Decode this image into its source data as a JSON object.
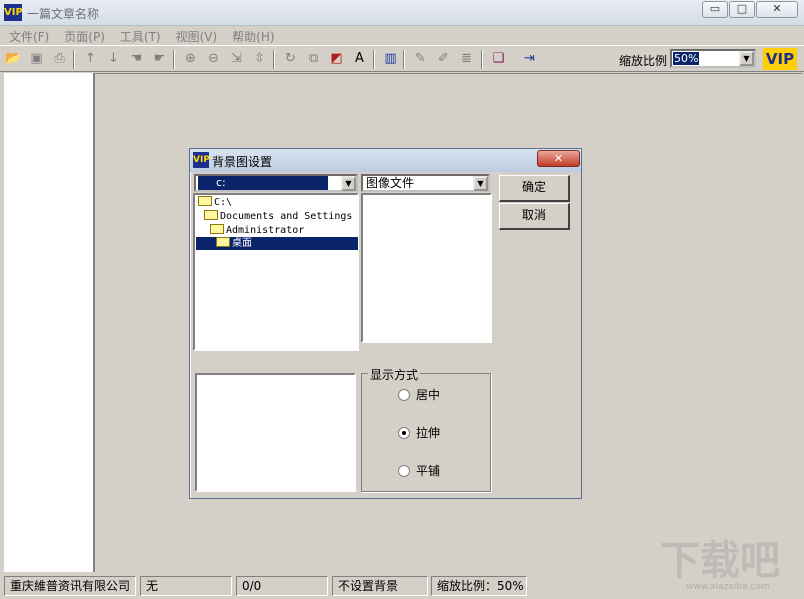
{
  "window": {
    "title": "一篇文章名称",
    "logo_text": "VIP",
    "minimize": "▭",
    "maximize": "□",
    "close": "✕"
  },
  "menu": [
    "文件(F)",
    "页面(P)",
    "工具(T)",
    "视图(V)",
    "帮助(H)"
  ],
  "toolbar": {
    "icons": [
      "open-icon",
      "save-icon",
      "print-icon",
      "arrow-up-icon",
      "arrow-down-icon",
      "hand-icon",
      "hand-right-icon",
      "zoom-in-icon",
      "zoom-out-icon",
      "rotate-left-icon",
      "rotate-right-icon",
      "refresh-icon",
      "copy-icon",
      "color-icon",
      "text-icon",
      "columns-icon",
      "tools-icon",
      "edit-icon",
      "list-icon",
      "book-icon",
      "exit-icon"
    ],
    "zoom_label": "缩放比例",
    "zoom_value": "50%",
    "brand_logo": "VIP"
  },
  "dialog": {
    "title": "背景图设置",
    "logo_text": "VIP",
    "close": "✕",
    "drive": "c:",
    "file_type": "图像文件",
    "folders": [
      "C:\\",
      "Documents and Settings",
      "Administrator",
      "桌面"
    ],
    "ok_label": "确定",
    "cancel_label": "取消",
    "display_mode": {
      "label": "显示方式",
      "options": [
        "居中",
        "拉伸",
        "平铺"
      ],
      "selected": "拉伸"
    }
  },
  "status": [
    "重庆維普资讯有限公司",
    "无",
    "0/0",
    "不设置背景",
    "缩放比例：50%"
  ],
  "watermark": {
    "text": "下载吧",
    "sub": "www.xiazaiba.com"
  }
}
